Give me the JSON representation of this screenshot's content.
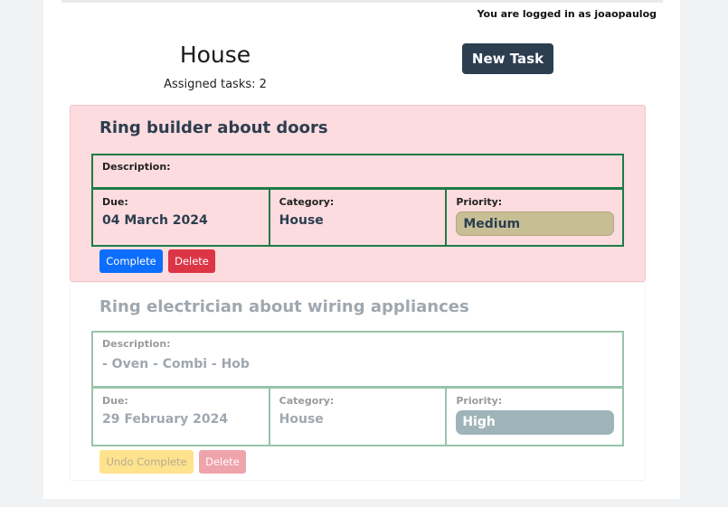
{
  "header": {
    "login_text": "You are logged in as joaopaulog",
    "title": "House",
    "assigned": "Assigned tasks: 2",
    "new_task_label": "New Task"
  },
  "colors": {
    "accent": "#2c3e50",
    "pending_bg": "#fddcdf",
    "complete_btn": "#0d6efd",
    "delete_btn": "#dc3545",
    "undo_btn": "#ffc107",
    "table_border": "#1e7b45",
    "priority_medium": "#c8be96",
    "priority_high": "#2c5a66"
  },
  "tasks": [
    {
      "title": "Ring builder about doors",
      "description_label": "Description:",
      "description": "",
      "due_label": "Due:",
      "due": "04 March 2024",
      "category_label": "Category:",
      "category": "House",
      "priority_label": "Priority:",
      "priority": "Medium",
      "primary_button": "Complete",
      "delete_button": "Delete"
    },
    {
      "title": "Ring electrician about wiring appliances",
      "description_label": "Description:",
      "description": "- Oven - Combi - Hob",
      "due_label": "Due:",
      "due": "29 February 2024",
      "category_label": "Category:",
      "category": "House",
      "priority_label": "Priority:",
      "priority": "High",
      "primary_button": "Undo Complete",
      "delete_button": "Delete"
    }
  ]
}
